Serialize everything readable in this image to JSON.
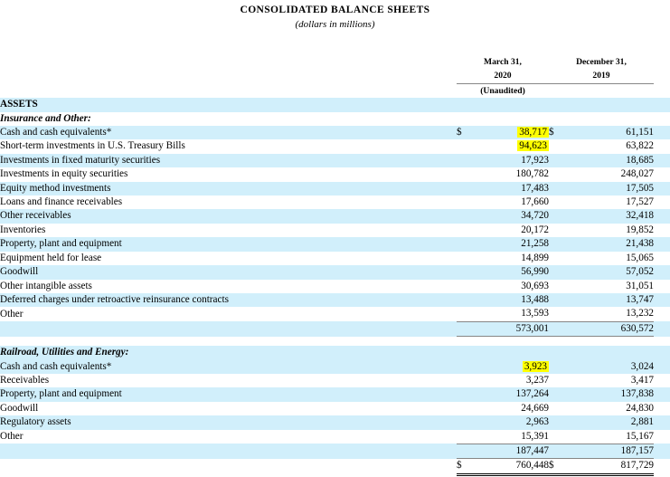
{
  "document": {
    "title": "CONSOLIDATED BALANCE SHEETS",
    "subtitle": "(dollars in millions)"
  },
  "columns": {
    "label_header": "",
    "col1": {
      "line1": "March 31,",
      "line2": "2020",
      "note": "(Unaudited)"
    },
    "col2": {
      "line1": "December 31,",
      "line2": "2019",
      "note": ""
    }
  },
  "currency_symbol": "$",
  "colors": {
    "row_shade": "#D1EFFB",
    "highlight": "#FFFF00",
    "rule": "#868686",
    "text": "#000000"
  },
  "sections": {
    "assets_heading": "ASSETS",
    "insurance": {
      "heading": "Insurance and Other:",
      "rows": [
        {
          "label": "Cash and cash equivalents*",
          "v1": "38,717",
          "v2": "61,151",
          "currency": true,
          "highlight1": true
        },
        {
          "label": "Short-term investments in U.S. Treasury Bills",
          "v1": "94,623",
          "v2": "63,822",
          "currency": false,
          "highlight1": true
        },
        {
          "label": "Investments in fixed maturity securities",
          "v1": "17,923",
          "v2": "18,685",
          "currency": false,
          "highlight1": false
        },
        {
          "label": "Investments in equity securities",
          "v1": "180,782",
          "v2": "248,027",
          "currency": false,
          "highlight1": false
        },
        {
          "label": "Equity method investments",
          "v1": "17,483",
          "v2": "17,505",
          "currency": false,
          "highlight1": false
        },
        {
          "label": "Loans and finance receivables",
          "v1": "17,660",
          "v2": "17,527",
          "currency": false,
          "highlight1": false
        },
        {
          "label": "Other receivables",
          "v1": "34,720",
          "v2": "32,418",
          "currency": false,
          "highlight1": false
        },
        {
          "label": "Inventories",
          "v1": "20,172",
          "v2": "19,852",
          "currency": false,
          "highlight1": false
        },
        {
          "label": "Property, plant and equipment",
          "v1": "21,258",
          "v2": "21,438",
          "currency": false,
          "highlight1": false
        },
        {
          "label": "Equipment held for lease",
          "v1": "14,899",
          "v2": "15,065",
          "currency": false,
          "highlight1": false
        },
        {
          "label": "Goodwill",
          "v1": "56,990",
          "v2": "57,052",
          "currency": false,
          "highlight1": false
        },
        {
          "label": "Other intangible assets",
          "v1": "30,693",
          "v2": "31,051",
          "currency": false,
          "highlight1": false
        },
        {
          "label": "Deferred charges under retroactive reinsurance contracts",
          "v1": "13,488",
          "v2": "13,747",
          "currency": false,
          "highlight1": false
        },
        {
          "label": "Other",
          "v1": "13,593",
          "v2": "13,232",
          "currency": false,
          "highlight1": false
        }
      ],
      "subtotal": {
        "label": "",
        "v1": "573,001",
        "v2": "630,572"
      }
    },
    "railroad": {
      "heading": "Railroad, Utilities and Energy:",
      "rows": [
        {
          "label": "Cash and cash equivalents*",
          "v1": "3,923",
          "v2": "3,024",
          "currency": false,
          "highlight1": true
        },
        {
          "label": "Receivables",
          "v1": "3,237",
          "v2": "3,417",
          "currency": false,
          "highlight1": false
        },
        {
          "label": "Property, plant and equipment",
          "v1": "137,264",
          "v2": "137,838",
          "currency": false,
          "highlight1": false
        },
        {
          "label": "Goodwill",
          "v1": "24,669",
          "v2": "24,830",
          "currency": false,
          "highlight1": false
        },
        {
          "label": "Regulatory assets",
          "v1": "2,963",
          "v2": "2,881",
          "currency": false,
          "highlight1": false
        },
        {
          "label": "Other",
          "v1": "15,391",
          "v2": "15,167",
          "currency": false,
          "highlight1": false
        }
      ],
      "subtotal": {
        "label": "",
        "v1": "187,447",
        "v2": "187,157"
      }
    },
    "grand_total": {
      "label": "",
      "v1": "760,448",
      "v2": "817,729",
      "currency": true
    }
  }
}
